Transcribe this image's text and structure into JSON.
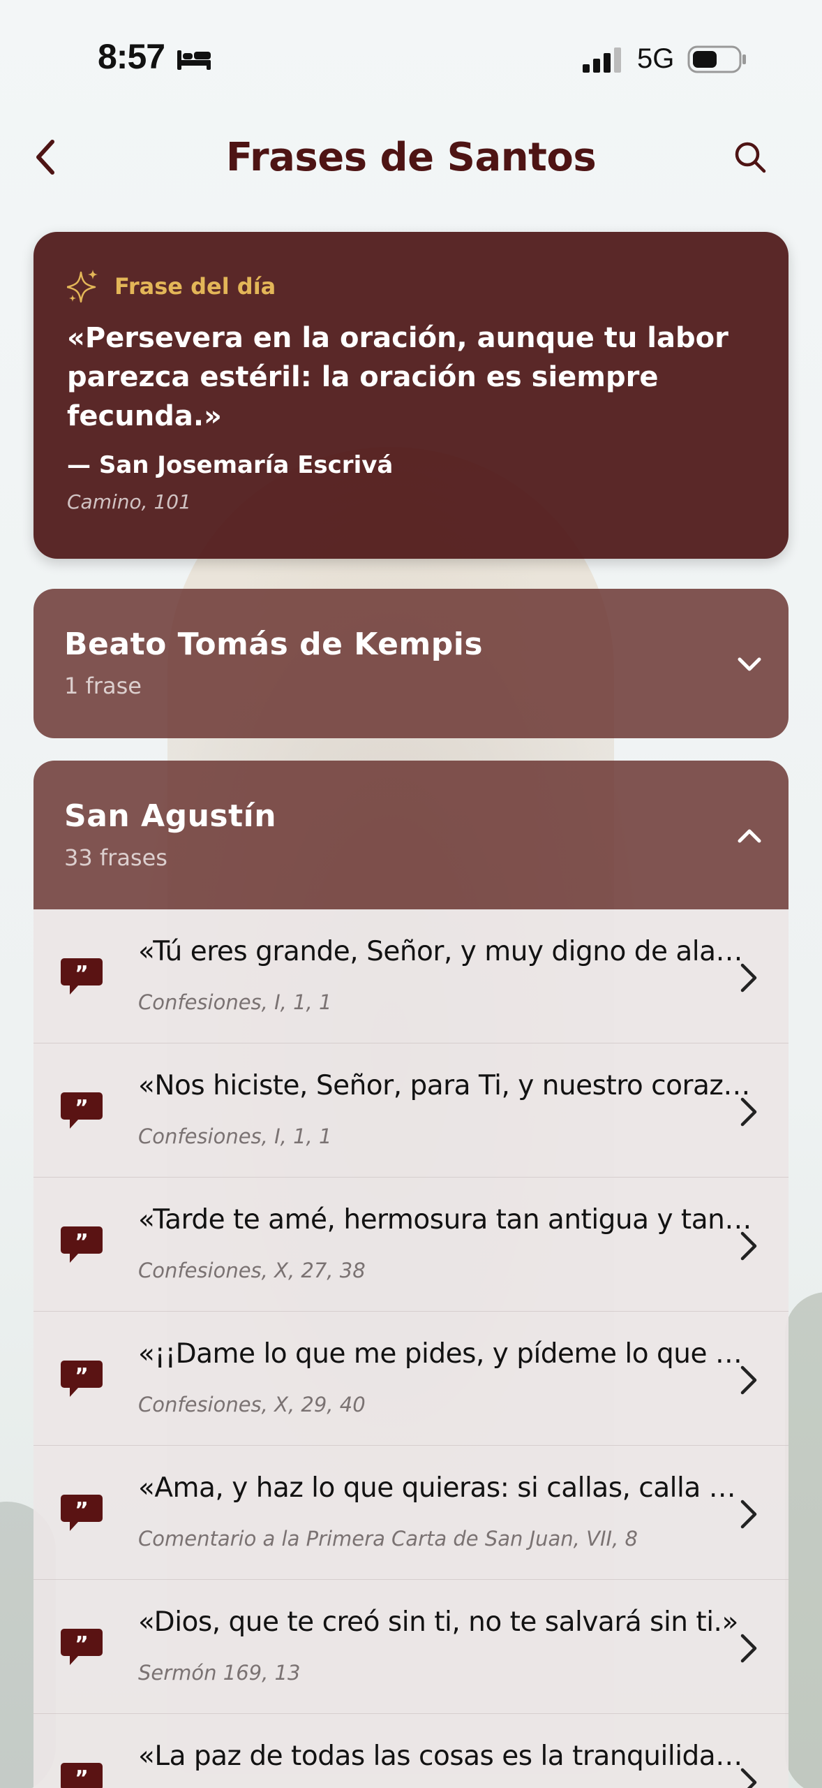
{
  "status_bar": {
    "time": "8:57",
    "network": "5G"
  },
  "nav": {
    "title": "Frases de Santos"
  },
  "quote_of_the_day": {
    "label": "Frase del día",
    "text": "«Persevera en la oración, aunque tu labor parezca estéril: la oración es siempre fecunda.»",
    "author": "— San Josemaría Escrivá",
    "source": "Camino, 101"
  },
  "saints": [
    {
      "name": "Beato Tomás de Kempis",
      "count": "1 frase",
      "expanded": false
    },
    {
      "name": "San Agustín",
      "count": "33 frases",
      "expanded": true
    }
  ],
  "quotes": [
    {
      "text": "«Tú eres grande, Señor, y muy digno de alabanza",
      "source": "Confesiones, I, 1, 1"
    },
    {
      "text": "«Nos hiciste, Señor, para Ti, y nuestro corazón está inquieto",
      "source": "Confesiones, I, 1, 1"
    },
    {
      "text": "«Tarde te amé, hermosura tan antigua y tan nueva",
      "source": "Confesiones, X, 27, 38"
    },
    {
      "text": "«¡¡Dame lo que me pides, y pídeme lo que quieras!!»",
      "source": "Confesiones, X, 29, 40"
    },
    {
      "text": "«Ama, y haz lo que quieras: si callas, calla por amor",
      "source": "Comentario a la Primera Carta de San Juan, VII, 8"
    },
    {
      "text": "«Dios, que te creó sin ti, no te salvará sin ti.»",
      "source": "Sermón 169, 13"
    },
    {
      "text": "«La paz de todas las cosas es la tranquilidad del orden",
      "source": ""
    }
  ],
  "colors": {
    "title": "#4e1414",
    "card_bg": "#4f1818",
    "accent_gold": "#e3b658",
    "saint_header_bg": "#6c3734",
    "quote_icon": "#5a1313"
  },
  "icons": {
    "back": "chevron-left-icon",
    "search": "search-icon",
    "sparkle": "sparkle-icon",
    "quote": "quote-bubble-icon",
    "expand": "chevron-down-icon",
    "collapse": "chevron-up-icon",
    "row": "chevron-right-icon"
  }
}
